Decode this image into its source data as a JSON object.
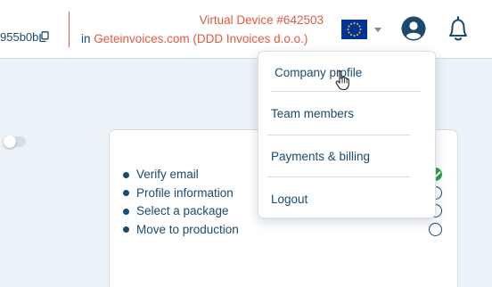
{
  "header": {
    "token_text": "955b0b",
    "device_label": "Virtual Device #642503",
    "company_prefix": "in",
    "company_name": "Geteinvoices.com (DDD Invoices d.o.o.)",
    "icons": {
      "copy": "copy-icon",
      "flag": "eu-flag-icon",
      "caret": "chevron-down-icon",
      "avatar": "user-avatar-icon",
      "bell": "bell-icon"
    }
  },
  "dropdown": {
    "items": [
      {
        "label": "Company profile"
      },
      {
        "label": "Team members"
      },
      {
        "label": "Payments & billing"
      },
      {
        "label": "Logout"
      }
    ]
  },
  "checklist": {
    "items": [
      {
        "label": "Verify email",
        "done": true
      },
      {
        "label": "Profile information",
        "done": false
      },
      {
        "label": "Select a package",
        "done": false
      },
      {
        "label": "Move to production",
        "done": false
      }
    ]
  },
  "colors": {
    "primary": "#1a4a6e",
    "accent": "#e2593f",
    "success": "#2e9e4a",
    "eu_blue": "#003399",
    "eu_yellow": "#ffcc00"
  }
}
